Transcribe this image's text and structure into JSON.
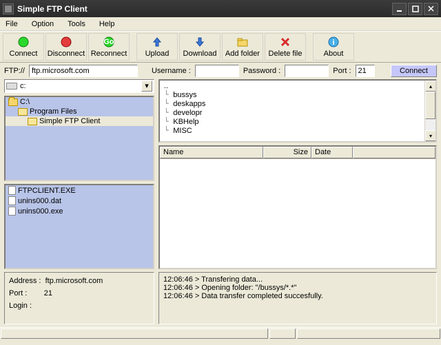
{
  "window": {
    "title": "Simple FTP Client"
  },
  "menu": {
    "file": "File",
    "option": "Option",
    "tools": "Tools",
    "help": "Help"
  },
  "toolbar": {
    "connect": "Connect",
    "disconnect": "Disconnect",
    "reconnect": "Reconnect",
    "upload": "Upload",
    "download": "Download",
    "addfolder": "Add folder",
    "deletefile": "Delete file",
    "about": "About"
  },
  "conn": {
    "ftp_label": "FTP://",
    "host": "ftp.microsoft.com",
    "user_label": "Username :",
    "username": "",
    "pass_label": "Password :",
    "password": "",
    "port_label": "Port :",
    "port": "21",
    "connect_btn": "Connect"
  },
  "local": {
    "drive": "c:",
    "tree": [
      {
        "label": "C:\\",
        "indent": 0,
        "open": false
      },
      {
        "label": "Program Files",
        "indent": 1,
        "open": true
      },
      {
        "label": "Simple FTP Client",
        "indent": 2,
        "open": true,
        "selected": true
      }
    ],
    "files": [
      {
        "name": "FTPCLIENT.EXE"
      },
      {
        "name": "unins000.dat"
      },
      {
        "name": "unins000.exe"
      }
    ]
  },
  "remote": {
    "tree": [
      {
        "label": ".."
      },
      {
        "label": "bussys"
      },
      {
        "label": "deskapps"
      },
      {
        "label": "developr"
      },
      {
        "label": "KBHelp"
      },
      {
        "label": "MISC"
      }
    ],
    "columns": {
      "name": "Name",
      "size": "Size",
      "date": "Date"
    }
  },
  "status": {
    "addr_label": "Address :",
    "addr": "ftp.microsoft.com",
    "port_label": "Port :",
    "port": "21",
    "login_label": "Login :",
    "login": ""
  },
  "log": [
    "12:06:46 > Transfering data...",
    "12:06:46 > Opening folder: \"/bussys/*.*\"",
    "12:06:46 > Data transfer completed succesfully."
  ]
}
